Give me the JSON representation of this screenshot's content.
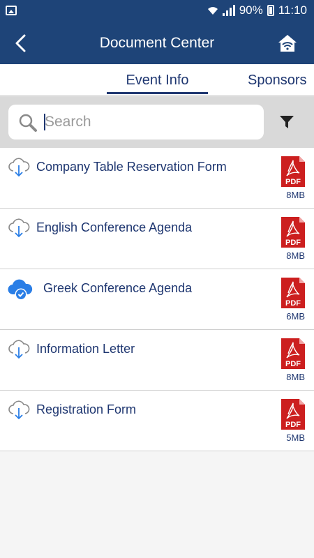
{
  "status_bar": {
    "battery": "90%",
    "time": "11:10"
  },
  "header": {
    "title": "Document Center"
  },
  "tabs": [
    {
      "label": "Event Info",
      "active": true
    },
    {
      "label": "Sponsors",
      "active": false
    }
  ],
  "search": {
    "placeholder": "Search",
    "value": ""
  },
  "documents": [
    {
      "title": "Company Table Reservation Form",
      "size": "8MB",
      "type": "PDF",
      "downloaded": false
    },
    {
      "title": "English Conference Agenda",
      "size": "8MB",
      "type": "PDF",
      "downloaded": false
    },
    {
      "title": "Greek Conference Agenda",
      "size": "6MB",
      "type": "PDF",
      "downloaded": true
    },
    {
      "title": "Information Letter",
      "size": "8MB",
      "type": "PDF",
      "downloaded": false
    },
    {
      "title": "Registration Form",
      "size": "5MB",
      "type": "PDF",
      "downloaded": false
    }
  ],
  "colors": {
    "brand": "#1e4478",
    "text": "#1e3670",
    "pdf_red": "#cc1f1f",
    "accent_blue": "#2a7ee6"
  },
  "icons": {
    "back": "chevron-left-icon",
    "home": "home-wifi-icon",
    "search": "search-icon",
    "filter": "filter-icon",
    "download": "cloud-download-icon",
    "downloaded": "cloud-check-icon",
    "pdf": "pdf-file-icon"
  }
}
